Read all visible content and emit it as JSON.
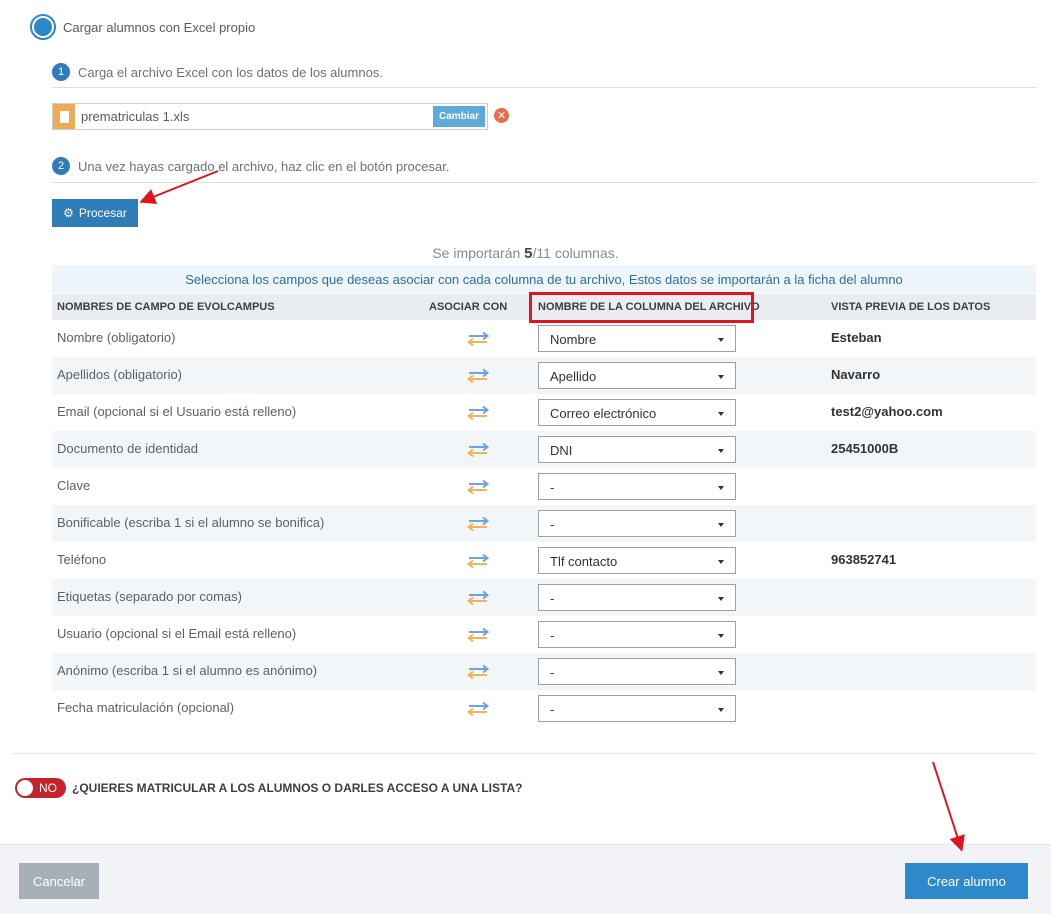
{
  "upload_option": {
    "label": "Cargar alumnos con Excel propio"
  },
  "step1": {
    "number": "1",
    "text": "Carga el archivo Excel con los datos de los alumnos."
  },
  "file": {
    "name": "prematriculas 1.xls",
    "change_label": "Cambiar",
    "remove_symbol": "✕"
  },
  "step2": {
    "number": "2",
    "text": "Una vez hayas cargado el archivo, haz clic en el botón procesar."
  },
  "process_button": {
    "label": "Procesar"
  },
  "import_summary": {
    "prefix": "Se importarán ",
    "count": "5",
    "suffix": "/11 columnas."
  },
  "info_bar": "Selecciona los campos que deseas asociar con cada columna de tu archivo, Estos datos se importarán a la ficha del alumno",
  "table": {
    "headers": [
      "NOMBRES DE CAMPO DE EVOLCAMPUS",
      "ASOCIAR CON",
      "NOMBRE DE LA COLUMNA DEL ARCHIVO",
      "VISTA PREVIA DE LOS DATOS"
    ],
    "rows": [
      {
        "field": "Nombre (obligatorio)",
        "column": "Nombre",
        "preview": "Esteban"
      },
      {
        "field": "Apellidos (obligatorio)",
        "column": "Apellido",
        "preview": "Navarro"
      },
      {
        "field": "Email (opcional si el Usuario está relleno)",
        "column": "Correo electrónico",
        "preview": "test2@yahoo.com"
      },
      {
        "field": "Documento de identidad",
        "column": "DNI",
        "preview": "25451000B"
      },
      {
        "field": "Clave",
        "column": "-",
        "preview": ""
      },
      {
        "field": "Bonificable (escriba 1 si el alumno se bonifica)",
        "column": "-",
        "preview": ""
      },
      {
        "field": "Teléfono",
        "column": "Tlf contacto",
        "preview": "963852741"
      },
      {
        "field": "Etiquetas (separado por comas)",
        "column": "-",
        "preview": ""
      },
      {
        "field": "Usuario (opcional si el Email está relleno)",
        "column": "-",
        "preview": ""
      },
      {
        "field": "Anónimo (escriba 1 si el alumno es anónimo)",
        "column": "-",
        "preview": ""
      },
      {
        "field": "Fecha matriculación (opcional)",
        "column": "-",
        "preview": ""
      }
    ]
  },
  "enroll": {
    "toggle_label": "NO",
    "question": "¿QUIERES MATRICULAR A LOS ALUMNOS O DARLES ACCESO A UNA LISTA?"
  },
  "footer": {
    "cancel_label": "Cancelar",
    "create_label": "Crear alumno"
  },
  "colors": {
    "primary": "#2e7cb8",
    "annotation": "#e0141b",
    "toggle_off": "#c4232b"
  }
}
